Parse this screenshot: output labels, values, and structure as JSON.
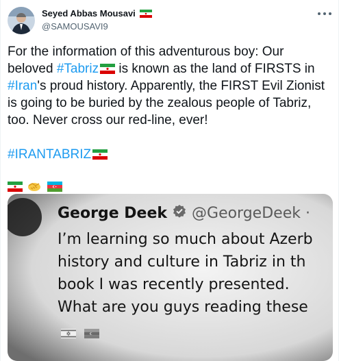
{
  "author": {
    "display_name": "Seyed Abbas Mousavi",
    "handle": "@SAMOUSAVI9"
  },
  "tweet": {
    "seg1": "For the information of this adventurous boy: Our beloved ",
    "tag_tabriz": "#Tabriz",
    "seg2": " is known as the land of FIRSTS in ",
    "tag_iran": "#Iran",
    "seg3": "'s proud history.  Apparently, the FIRST Evil Zionist is going to be buried by the zealous people of Tabriz, too. Never cross our red-line, ever!",
    "tag_irantabriz": "#IRANTABRIZ"
  },
  "embedded_image": {
    "name": "George Deek",
    "handle": "@GeorgeDeek ·",
    "lines": [
      "I’m learning so much about Azerb",
      "history and culture in Tabriz in th",
      "book I was recently presented.",
      "What are you guys reading these"
    ]
  },
  "icons": {
    "flag_iran": "iran-flag-icon",
    "flag_azerbaijan": "azerbaijan-flag-icon",
    "flag_israel": "israel-flag-icon",
    "handshake": "handshake-icon",
    "verified": "verified-badge-icon",
    "more": "more-options-icon"
  },
  "colors": {
    "link": "#1d9bf0",
    "text": "#0f1419",
    "secondary": "#536471"
  }
}
